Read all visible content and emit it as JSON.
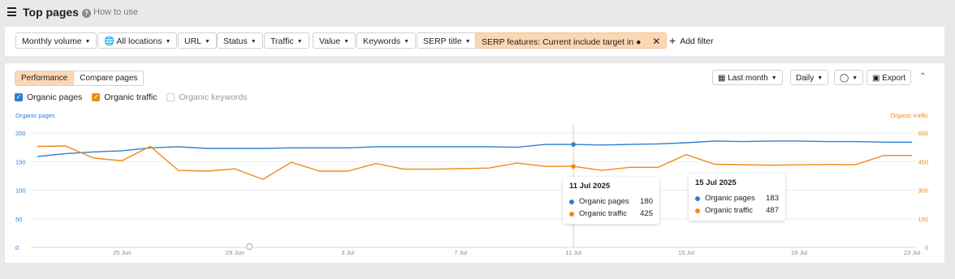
{
  "header": {
    "title": "Top pages",
    "help": "How to use"
  },
  "filters": {
    "items": [
      {
        "label": "Monthly volume"
      },
      {
        "label": "All locations"
      },
      {
        "label": "URL"
      },
      {
        "label": "Status"
      },
      {
        "label": "Traffic"
      },
      {
        "label": "Value"
      },
      {
        "label": "Keywords"
      },
      {
        "label": "SERP title"
      }
    ],
    "serp_features": "SERP features: Current include target in",
    "add_filter": "Add filter"
  },
  "panel": {
    "tabs": [
      "Performance",
      "Compare pages"
    ],
    "date_range": "Last month",
    "granularity": "Daily",
    "export": "Export",
    "legend": [
      "Organic pages",
      "Organic traffic",
      "Organic keywords"
    ]
  },
  "tooltips": [
    {
      "date": "11 Jul 2025",
      "pages_label": "Organic pages",
      "pages": "180",
      "traffic_label": "Organic traffic",
      "traffic": "425"
    },
    {
      "date": "15 Jul 2025",
      "pages_label": "Organic pages",
      "pages": "183",
      "traffic_label": "Organic traffic",
      "traffic": "487"
    }
  ],
  "colors": {
    "pages": "#2e7fd1",
    "traffic": "#ef8a17",
    "accent": "#fcd7b4"
  },
  "chart_data": {
    "type": "line",
    "y_left_label": "Organic pages",
    "y_right_label": "Organic traffic",
    "ylim_left": [
      0,
      200
    ],
    "ylim_right": [
      0,
      600
    ],
    "y_left_ticks": [
      "0",
      "50",
      "100",
      "150",
      "200"
    ],
    "y_right_ticks": [
      "0",
      "150",
      "300",
      "450",
      "600"
    ],
    "x_ticks": [
      "25 Jun",
      "29 Jun",
      "3 Jul",
      "7 Jul",
      "11 Jul",
      "15 Jul",
      "19 Jul",
      "23 Jul"
    ],
    "x": [
      "22 Jun",
      "23 Jun",
      "24 Jun",
      "25 Jun",
      "26 Jun",
      "27 Jun",
      "28 Jun",
      "29 Jun",
      "30 Jun",
      "1 Jul",
      "2 Jul",
      "3 Jul",
      "4 Jul",
      "5 Jul",
      "6 Jul",
      "7 Jul",
      "8 Jul",
      "9 Jul",
      "10 Jul",
      "11 Jul",
      "12 Jul",
      "13 Jul",
      "14 Jul",
      "15 Jul",
      "16 Jul",
      "17 Jul",
      "18 Jul",
      "19 Jul",
      "20 Jul",
      "21 Jul",
      "22 Jul",
      "23 Jul"
    ],
    "series": [
      {
        "name": "Organic pages",
        "axis": "left",
        "values": [
          159,
          164,
          167,
          169,
          174,
          176,
          173,
          173,
          173,
          174,
          174,
          174,
          176,
          176,
          176,
          176,
          176,
          175,
          180,
          180,
          179,
          180,
          181,
          183,
          186,
          185,
          186,
          186,
          185,
          185,
          184,
          184
        ]
      },
      {
        "name": "Organic traffic",
        "axis": "right",
        "values": [
          530,
          532,
          468,
          455,
          530,
          404,
          400,
          412,
          357,
          447,
          400,
          400,
          440,
          410,
          410,
          413,
          416,
          442,
          425,
          425,
          404,
          420,
          420,
          487,
          436,
          434,
          431,
          433,
          435,
          434,
          482,
          482
        ]
      }
    ]
  }
}
